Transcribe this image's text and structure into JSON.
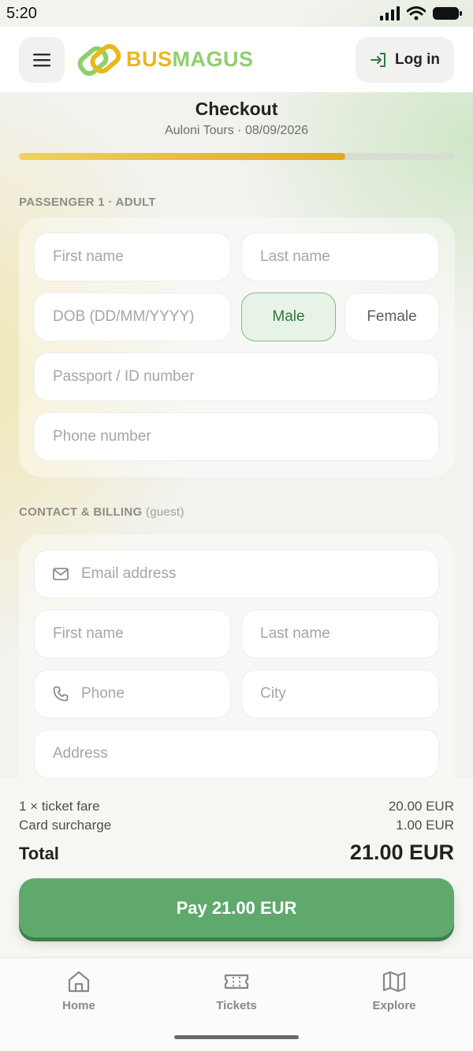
{
  "status_bar": {
    "time": "5:20"
  },
  "header": {
    "menu_icon": "hamburger-menu-icon",
    "logo": {
      "word_part1": "BUS",
      "word_part2": "MAGUS",
      "colors": {
        "primary": "#e7b91c",
        "secondary": "#8fcf6c"
      }
    },
    "login": {
      "label": "Log in",
      "icon": "login-arrow-icon"
    }
  },
  "checkout": {
    "title": "Checkout",
    "subtitle": "Auloni Tours · 08/09/2026",
    "progress": 0.75
  },
  "passenger": {
    "section_label": "PASSENGER 1 · ADULT",
    "first_name_placeholder": "First name",
    "last_name_placeholder": "Last name",
    "dob_placeholder": "DOB (DD/MM/YYYY)",
    "gender_options": [
      "Male",
      "Female"
    ],
    "gender_selected": "Male",
    "passport_placeholder": "Passport / ID number",
    "phone_placeholder": "Phone number"
  },
  "contact": {
    "section_label": "CONTACT & BILLING",
    "section_hint": "(guest)",
    "email_placeholder": "Email address",
    "first_name_placeholder": "First name",
    "last_name_placeholder": "Last name",
    "phone_placeholder": "Phone",
    "city_placeholder": "City",
    "address_placeholder": "Address"
  },
  "summary": {
    "lines": [
      {
        "label": "1 × ticket fare",
        "value": "20.00 EUR"
      },
      {
        "label": "Card surcharge",
        "value": "1.00 EUR"
      }
    ],
    "total_label": "Total",
    "total_value": "21.00 EUR",
    "pay_button": "Pay 21.00 EUR"
  },
  "tabs": [
    {
      "label": "Home",
      "icon": "home-icon"
    },
    {
      "label": "Tickets",
      "icon": "ticket-icon"
    },
    {
      "label": "Explore",
      "icon": "map-icon"
    }
  ],
  "colors": {
    "accent": "#5fa96c",
    "progress": "#e0aa1c",
    "selected_bg": "#e8f3e7"
  }
}
